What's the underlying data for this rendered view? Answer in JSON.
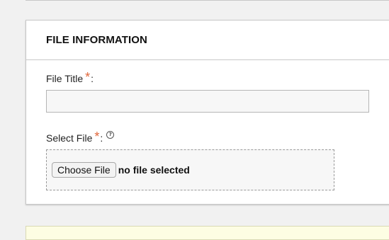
{
  "section": {
    "title": "FILE INFORMATION"
  },
  "file_title": {
    "label": "File Title",
    "required_marker": "*",
    "colon": ":",
    "value": ""
  },
  "select_file": {
    "label": "Select File",
    "required_marker": "*",
    "colon": ":",
    "help_icon": "?",
    "choose_button": "Choose File",
    "status": "no file selected"
  },
  "colors": {
    "required": "#e0663a",
    "notice_background": "#fdfde3"
  }
}
